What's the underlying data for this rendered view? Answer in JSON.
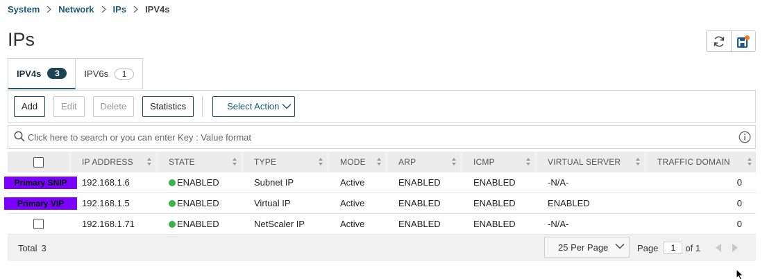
{
  "breadcrumb": {
    "items": [
      "System",
      "Network",
      "IPs"
    ],
    "current": "IPV4s"
  },
  "page": {
    "title": "IPs"
  },
  "top_actions": {
    "refresh_icon": "refresh-icon",
    "save_icon": "save-config-icon",
    "accent": "#f07b2a"
  },
  "tabs": [
    {
      "label": "IPV4s",
      "count": "3"
    },
    {
      "label": "IPV6s",
      "count": "1"
    }
  ],
  "toolbar": {
    "add": "Add",
    "edit": "Edit",
    "delete": "Delete",
    "statistics": "Statistics",
    "select_action": "Select Action"
  },
  "search": {
    "placeholder": "Click here to search or you can enter Key : Value format"
  },
  "table": {
    "columns": [
      "IP ADDRESS",
      "STATE",
      "TYPE",
      "MODE",
      "ARP",
      "ICMP",
      "VIRTUAL SERVER",
      "TRAFFIC DOMAIN"
    ],
    "rows": [
      {
        "tag": "Primary SNIP",
        "ip": "192.168.1.6",
        "state": "ENABLED",
        "type": "Subnet IP",
        "mode": "Active",
        "arp": "ENABLED",
        "icmp": "ENABLED",
        "vserver": "-N/A-",
        "td": "0"
      },
      {
        "tag": "Primary VIP",
        "ip": "192.168.1.5",
        "state": "ENABLED",
        "type": "Virtual IP",
        "mode": "Active",
        "arp": "ENABLED",
        "icmp": "ENABLED",
        "vserver": "ENABLED",
        "td": "0"
      },
      {
        "tag": "",
        "ip": "192.168.1.71",
        "state": "ENABLED",
        "type": "NetScaler IP",
        "mode": "Active",
        "arp": "ENABLED",
        "icmp": "ENABLED",
        "vserver": "-N/A-",
        "td": "0"
      }
    ],
    "tag_color": "#7b00ff",
    "state_color": "#38b54a"
  },
  "footer": {
    "total_label": "Total",
    "total_value": "3",
    "per_page": "25 Per Page",
    "page_label": "Page",
    "page_value": "1",
    "of_label": "of 1"
  }
}
